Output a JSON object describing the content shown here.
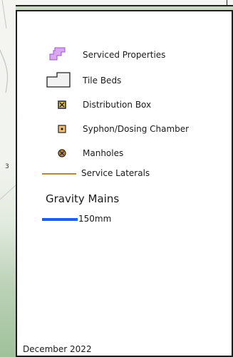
{
  "legend": {
    "items": [
      {
        "label": "Serviced Properties",
        "symbol": "serviced-property",
        "color": "#d9a8f0"
      },
      {
        "label": "Tile Beds",
        "symbol": "tile-bed",
        "color": "#f2f2f2"
      },
      {
        "label": "Distribution Box",
        "symbol": "distribution-box",
        "color": "#e3c06a"
      },
      {
        "label": "Syphon/Dosing Chamber",
        "symbol": "dosing-chamber",
        "color": "#f3c27a"
      },
      {
        "label": "Manholes",
        "symbol": "manhole",
        "color": "#c98a2a"
      },
      {
        "label": "Service Laterals",
        "symbol": "service-lateral-line",
        "color": "#b8862b"
      }
    ],
    "gravity_heading": "Gravity Mains",
    "gravity_items": [
      {
        "label": "150mm",
        "symbol": "gravity-main-line",
        "color": "#1f5ee8"
      }
    ],
    "date": "December 2022"
  },
  "map": {
    "edge_label": "3"
  }
}
